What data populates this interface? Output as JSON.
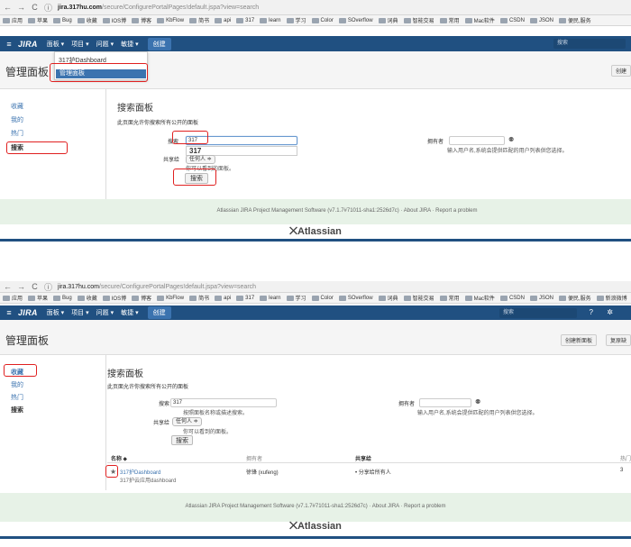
{
  "browser": {
    "back": "←",
    "forward": "→",
    "reload": "C",
    "secure": "ⓘ",
    "url_host": "jira.317hu.com",
    "url_path": "/secure/ConfigurePortalPages!default.jspa?view=search",
    "bookmarks_top": [
      "应用",
      "苹果",
      "Bug",
      "收藏",
      "IOS博",
      "博客",
      "KbFlow",
      "简书",
      "api",
      "317",
      "learn",
      "学习",
      "Color",
      "SOverflow",
      "词典",
      "智能交易",
      "常用",
      "Mac软件",
      "CSDN",
      "JSON",
      "便民,服务"
    ],
    "bookmarks_bottom": [
      "应用",
      "苹果",
      "Bug",
      "收藏",
      "IOS博",
      "博客",
      "KbFlow",
      "简书",
      "api",
      "317",
      "learn",
      "学习",
      "Color",
      "SOverflow",
      "词典",
      "智能交易",
      "常用",
      "Mac软件",
      "CSDN",
      "JSON",
      "便民,服务",
      "新浪微博"
    ]
  },
  "jira_nav": {
    "menu_icon": "≡",
    "logo": "JIRA",
    "items": [
      "面板 ▾",
      "项目 ▾",
      "问题 ▾",
      "敏捷 ▾"
    ],
    "create": "创建",
    "search_placeholder": "搜索",
    "help": "?",
    "settings": "✲"
  },
  "dashboard_dropdown": {
    "items": [
      "317护Dashboard"
    ],
    "selected": "管理面板"
  },
  "page": {
    "title": "管理面板",
    "create_btn": "创建",
    "create_btn_full": "创建新面板",
    "restore_btn": "复原缺"
  },
  "sidebar": {
    "items": [
      "收藏",
      "我的",
      "热门",
      "搜索"
    ]
  },
  "search_panel": {
    "heading": "搜索面板",
    "description": "此页面允许你搜索所有公开的面板",
    "search_label": "搜索",
    "search_value_top": "317",
    "search_value_bottom": "317",
    "search_hint": "按照面板名称或描述搜索。",
    "autocomplete": "317",
    "share_label": "共享给",
    "share_value": "任何人 ≑",
    "share_hint": "你可以看到的面板。",
    "owner_label": "拥有者",
    "owner_icon": "⚉",
    "owner_hint": "输入用户名,系统会提供匹配的用户列表供您选择。",
    "search_btn": "搜索"
  },
  "results": {
    "col_name": "名称 ⬥",
    "col_owner": "拥有者",
    "col_share": "共享给",
    "col_popular": "热门",
    "rows": [
      {
        "star": "★",
        "name": "317护Dashboard",
        "sub": "317护云应用dashboard",
        "owner": "徐锋 (xufeng)",
        "share": "• 分享给所有人",
        "popular": "3"
      }
    ]
  },
  "footer": {
    "line": "Atlassian JIRA Project Management Software (v7.1.7#71011-sha1:2526d7c)  ·  About JIRA  ·  Report a problem",
    "brand": "Atlassian"
  },
  "colors": {
    "nav": "#205081",
    "link": "#3b73af",
    "highlight": "#e02020",
    "footer": "#e7f2e7"
  }
}
